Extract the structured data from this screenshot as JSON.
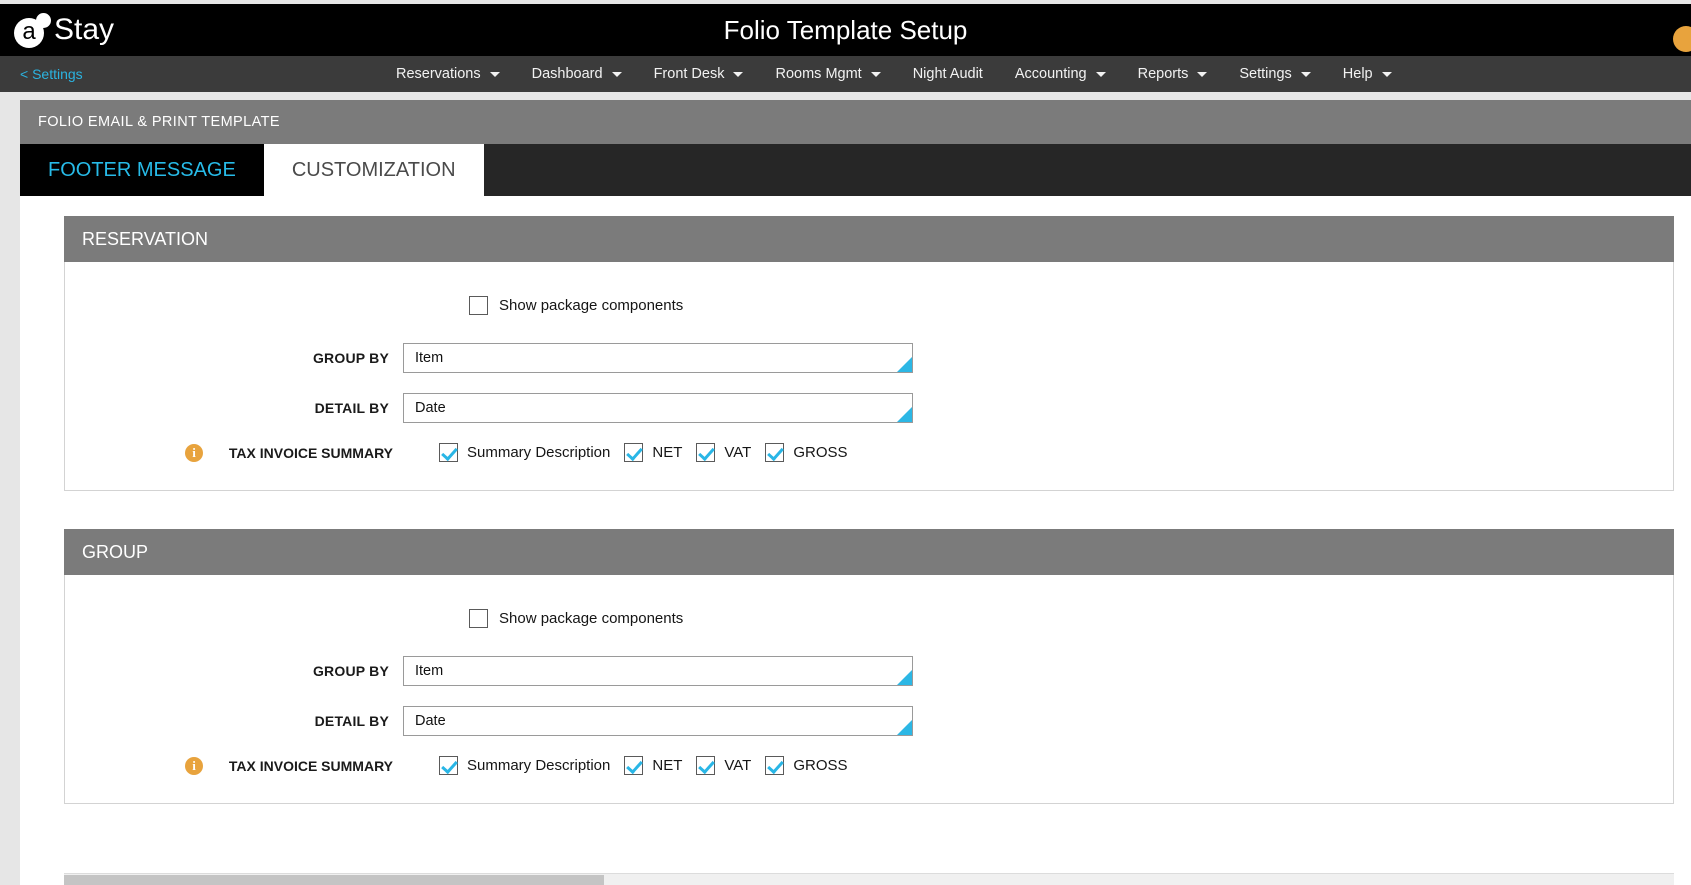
{
  "header": {
    "logo_text": "Stay",
    "logo_mark_letter": "a",
    "title": "Folio Template Setup",
    "avatar_icon": "user-avatar-icon"
  },
  "nav": {
    "back_label": "< Settings",
    "items": [
      {
        "label": "Reservations",
        "has_caret": true
      },
      {
        "label": "Dashboard",
        "has_caret": true
      },
      {
        "label": "Front Desk",
        "has_caret": true
      },
      {
        "label": "Rooms Mgmt",
        "has_caret": true
      },
      {
        "label": "Night Audit",
        "has_caret": false
      },
      {
        "label": "Accounting",
        "has_caret": true
      },
      {
        "label": "Reports",
        "has_caret": true
      },
      {
        "label": "Settings",
        "has_caret": true
      },
      {
        "label": "Help",
        "has_caret": true
      }
    ]
  },
  "panel": {
    "header_title": "FOLIO EMAIL & PRINT TEMPLATE",
    "tabs": [
      {
        "label": "FOOTER MESSAGE",
        "active": false
      },
      {
        "label": "CUSTOMIZATION",
        "active": true
      }
    ]
  },
  "sections": [
    {
      "title": "RESERVATION",
      "show_package_label": "Show package components",
      "show_package_checked": false,
      "group_by_label": "GROUP BY",
      "group_by_value": "Item",
      "detail_by_label": "DETAIL BY",
      "detail_by_value": "Date",
      "tax_summary_label": "TAX INVOICE SUMMARY",
      "info_icon": "info-icon",
      "tax_options": [
        {
          "label": "Summary Description",
          "checked": true
        },
        {
          "label": "NET",
          "checked": true
        },
        {
          "label": "VAT",
          "checked": true
        },
        {
          "label": "GROSS",
          "checked": true
        }
      ]
    },
    {
      "title": "GROUP",
      "show_package_label": "Show package components",
      "show_package_checked": false,
      "group_by_label": "GROUP BY",
      "group_by_value": "Item",
      "detail_by_label": "DETAIL BY",
      "detail_by_value": "Date",
      "tax_summary_label": "TAX INVOICE SUMMARY",
      "info_icon": "info-icon",
      "tax_options": [
        {
          "label": "Summary Description",
          "checked": true
        },
        {
          "label": "NET",
          "checked": true
        },
        {
          "label": "VAT",
          "checked": true
        },
        {
          "label": "GROSS",
          "checked": true
        }
      ]
    }
  ],
  "colors": {
    "accent_cyan": "#27bbe8",
    "header_black": "#000000",
    "nav_gray": "#3b3b3b",
    "section_gray": "#7b7b7b",
    "info_orange": "#e8a33d"
  }
}
